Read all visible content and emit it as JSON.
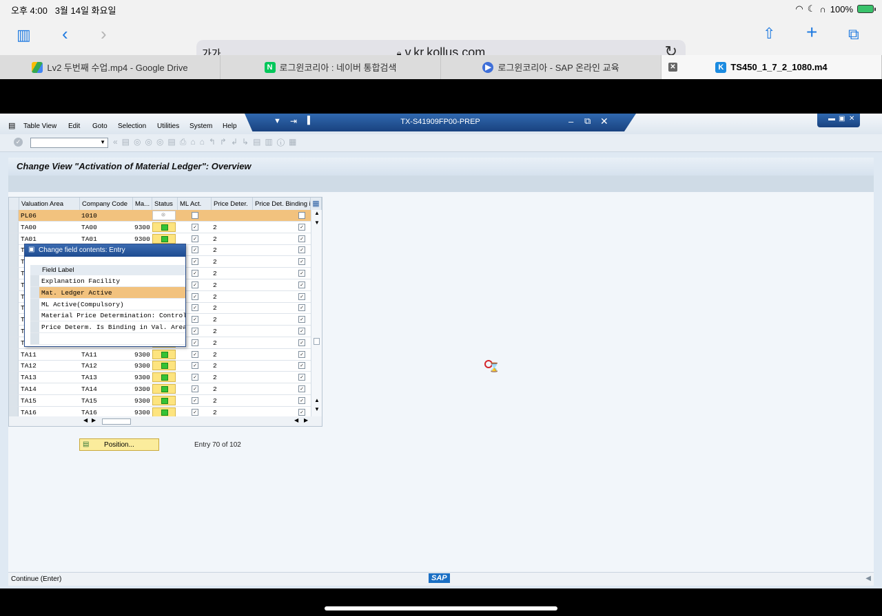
{
  "status_bar": {
    "time": "오후 4:00",
    "date": "3월 14일 화요일",
    "battery": "100%"
  },
  "safari": {
    "text_size": "가가",
    "url": "v.kr.kollus.com"
  },
  "tabs": [
    {
      "label": "Lv2 두번째 수업.mp4 - Google Drive",
      "icon": "google-drive-icon"
    },
    {
      "label": "로그윈코리아 : 네이버 통합검색",
      "icon": "naver-icon"
    },
    {
      "label": "로그윈코리아 - SAP 온라인 교육",
      "icon": "play-icon"
    },
    {
      "label": "TS450_1_7_2_1080.m4",
      "icon": "kollus-icon",
      "active": true
    }
  ],
  "sap": {
    "menu": [
      "Table View",
      "Edit",
      "Goto",
      "Selection",
      "Utilities",
      "System",
      "Help"
    ],
    "system_title": "TX-S41909FP00-PREP",
    "screen_title": "Change View \"Activation of Material Ledger\": Overview",
    "columns": [
      "Valuation Area",
      "Company Code",
      "Ma...",
      "Status",
      "ML Act.",
      "Price Deter.",
      "Price Det. Binding i"
    ],
    "rows": [
      {
        "area": "PL06",
        "company": "1010",
        "ma": "",
        "price": "",
        "ml": false,
        "binding": false,
        "selected": true,
        "status": "inactive"
      },
      {
        "area": "TA00",
        "company": "TA00",
        "ma": "9300",
        "price": "2",
        "ml": true,
        "binding": true
      },
      {
        "area": "TA01",
        "company": "TA01",
        "ma": "9300",
        "price": "2",
        "ml": true,
        "binding": true
      },
      {
        "area": "T",
        "company": "",
        "ma": "",
        "price": "2",
        "ml": true,
        "binding": true
      },
      {
        "area": "T",
        "company": "",
        "ma": "",
        "price": "2",
        "ml": true,
        "binding": true
      },
      {
        "area": "T",
        "company": "",
        "ma": "",
        "price": "2",
        "ml": true,
        "binding": true
      },
      {
        "area": "T",
        "company": "",
        "ma": "",
        "price": "2",
        "ml": true,
        "binding": true
      },
      {
        "area": "T",
        "company": "",
        "ma": "",
        "price": "2",
        "ml": true,
        "binding": true
      },
      {
        "area": "T",
        "company": "",
        "ma": "",
        "price": "2",
        "ml": true,
        "binding": true
      },
      {
        "area": "T",
        "company": "",
        "ma": "",
        "price": "2",
        "ml": true,
        "binding": true
      },
      {
        "area": "T",
        "company": "",
        "ma": "",
        "price": "2",
        "ml": true,
        "binding": true
      },
      {
        "area": "T",
        "company": "",
        "ma": "",
        "price": "2",
        "ml": true,
        "binding": true
      },
      {
        "area": "TA11",
        "company": "TA11",
        "ma": "9300",
        "price": "2",
        "ml": true,
        "binding": true
      },
      {
        "area": "TA12",
        "company": "TA12",
        "ma": "9300",
        "price": "2",
        "ml": true,
        "binding": true
      },
      {
        "area": "TA13",
        "company": "TA13",
        "ma": "9300",
        "price": "2",
        "ml": true,
        "binding": true
      },
      {
        "area": "TA14",
        "company": "TA14",
        "ma": "9300",
        "price": "2",
        "ml": true,
        "binding": true
      },
      {
        "area": "TA15",
        "company": "TA15",
        "ma": "9300",
        "price": "2",
        "ml": true,
        "binding": true
      },
      {
        "area": "TA16",
        "company": "TA16",
        "ma": "9300",
        "price": "2",
        "ml": true,
        "binding": true
      }
    ],
    "popup": {
      "title": "Change field contents: Entry",
      "header": "Field Label",
      "items": [
        "Explanation Facility",
        "Mat. Ledger Active",
        "ML Active(Compulsory)",
        "Material Price Determination: Control",
        "Price Determ. Is Binding in Val. Area"
      ],
      "selected_index": 1
    },
    "position_button": "Position...",
    "entry_info": "Entry 70 of 102",
    "status_text": "Continue   (Enter)",
    "logo": "SAP"
  }
}
